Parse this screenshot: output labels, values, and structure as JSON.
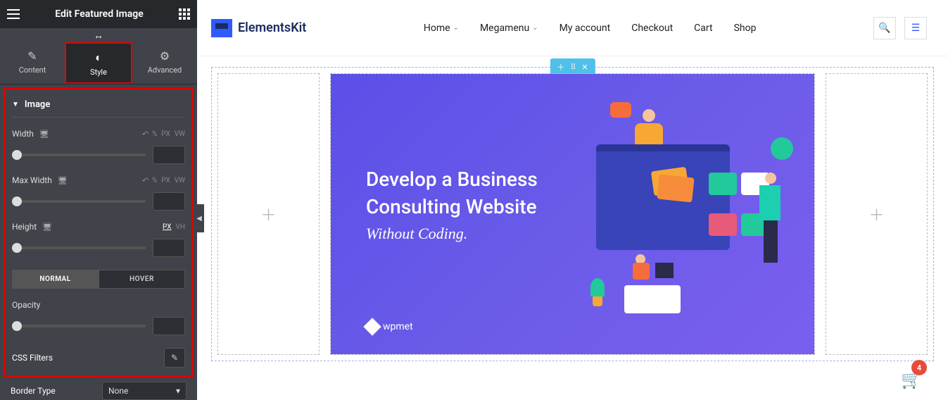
{
  "panel": {
    "title": "Edit Featured Image",
    "tabs": {
      "content": "Content",
      "style": "Style",
      "advanced": "Advanced"
    },
    "section": "Image",
    "width_label": "Width",
    "maxwidth_label": "Max Width",
    "height_label": "Height",
    "units": {
      "pct": "%",
      "px": "PX",
      "vw": "VW",
      "vh": "VH"
    },
    "state_normal": "NORMAL",
    "state_hover": "HOVER",
    "opacity_label": "Opacity",
    "filters_label": "CSS Filters",
    "border_label": "Border Type",
    "border_value": "None"
  },
  "site": {
    "logo_text": "ElementsKit",
    "nav": [
      "Home",
      "Megamenu",
      "My account",
      "Checkout",
      "Cart",
      "Shop"
    ]
  },
  "feature": {
    "line1": "Develop a Business",
    "line2": "Consulting Website",
    "sub": "Without Coding.",
    "brand": "wpmet"
  },
  "cart_count": "4"
}
